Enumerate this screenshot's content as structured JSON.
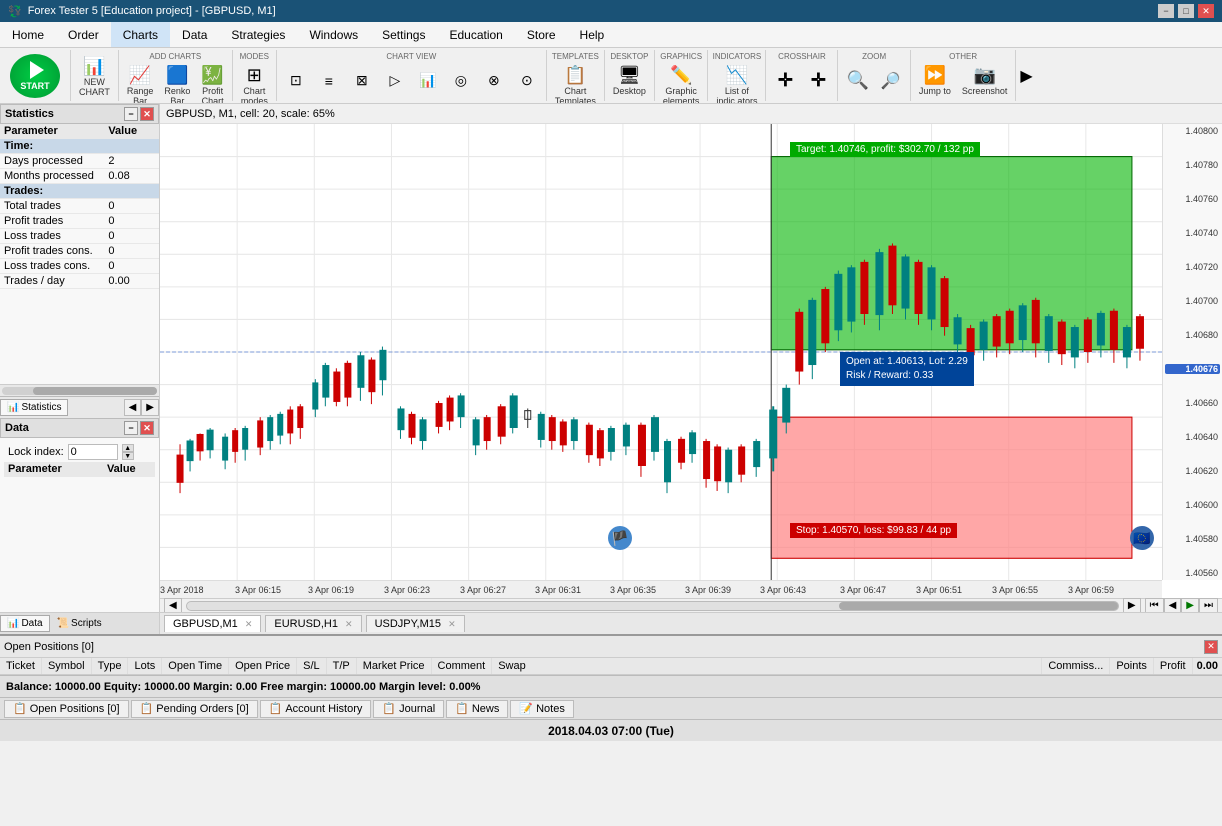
{
  "titleBar": {
    "title": "Forex Tester 5 [Education project] - [GBPUSD, M1]",
    "minimize": "−",
    "maximize": "□",
    "close": "✕"
  },
  "menuBar": {
    "items": [
      "Home",
      "Order",
      "Charts",
      "Data",
      "Strategies",
      "Windows",
      "Settings",
      "Education",
      "Store",
      "Help"
    ]
  },
  "toolbar": {
    "sections": [
      {
        "label": "",
        "items": [
          {
            "label": "NEW\nCHART",
            "icon": "📊"
          }
        ]
      },
      {
        "label": "ADD CHARTS",
        "items": [
          {
            "label": "Range\nBar",
            "icon": "📈"
          },
          {
            "label": "Renko\nBar",
            "icon": "🟦"
          },
          {
            "label": "Profit\nChart",
            "icon": "💹"
          }
        ]
      },
      {
        "label": "MODES",
        "items": [
          {
            "label": "Chart\nmodes",
            "icon": "⊞"
          }
        ]
      },
      {
        "label": "CHART VIEW",
        "items": [
          {
            "label": "",
            "icon": "⊡"
          },
          {
            "label": "",
            "icon": "≡"
          },
          {
            "label": "",
            "icon": "⊠"
          },
          {
            "label": "",
            "icon": "⊳"
          },
          {
            "label": "",
            "icon": "📊"
          },
          {
            "label": "",
            "icon": "⊚"
          },
          {
            "label": "",
            "icon": "⊘"
          },
          {
            "label": "",
            "icon": "⊙"
          }
        ]
      },
      {
        "label": "TEMPLATES",
        "items": [
          {
            "label": "Chart\nTemplates",
            "icon": "📋"
          }
        ]
      },
      {
        "label": "DESKTOP",
        "items": [
          {
            "label": "Desktop",
            "icon": "🖥"
          }
        ]
      },
      {
        "label": "GRAPHICS",
        "items": [
          {
            "label": "Graphic\nelements",
            "icon": "✏️"
          }
        ]
      },
      {
        "label": "INDICATORS",
        "items": [
          {
            "label": "List of\nindic ators",
            "icon": "📉"
          }
        ]
      },
      {
        "label": "CROSSHAIR",
        "items": [
          {
            "label": "",
            "icon": "✛"
          },
          {
            "label": "",
            "icon": "✛"
          }
        ]
      },
      {
        "label": "ZOOM",
        "items": [
          {
            "label": "",
            "icon": "🔍"
          },
          {
            "label": "",
            "icon": "🔎"
          }
        ]
      },
      {
        "label": "OTHER",
        "items": [
          {
            "label": "Jump to",
            "icon": "⏩"
          },
          {
            "label": "Screenshot",
            "icon": "📷"
          }
        ]
      }
    ]
  },
  "leftPanel": {
    "statistics": {
      "title": "Statistics",
      "colParam": "Parameter",
      "colValue": "Value",
      "sections": [
        {
          "type": "header",
          "param": "Parameter",
          "value": "Value"
        },
        {
          "type": "section",
          "param": "Time:",
          "value": ""
        },
        {
          "type": "row",
          "param": "Days processed",
          "value": "2"
        },
        {
          "type": "row",
          "param": "Months processed",
          "value": "0.08"
        },
        {
          "type": "section",
          "param": "Trades:",
          "value": ""
        },
        {
          "type": "row",
          "param": "Total trades",
          "value": "0"
        },
        {
          "type": "row",
          "param": "Profit trades",
          "value": "0"
        },
        {
          "type": "row",
          "param": "Loss trades",
          "value": "0"
        },
        {
          "type": "row",
          "param": "Profit trades cons.",
          "value": "0"
        },
        {
          "type": "row",
          "param": "Loss trades cons.",
          "value": "0"
        },
        {
          "type": "row",
          "param": "Trades / day",
          "value": "0.00"
        }
      ]
    },
    "dataPanel": {
      "title": "Data",
      "lockIndex": "Lock index:",
      "lockValue": "0",
      "colParam": "Parameter",
      "colValue": "Value"
    },
    "tabs": [
      {
        "label": "Statistics",
        "icon": "📊"
      },
      {
        "label": "►",
        "icon": ""
      }
    ]
  },
  "chart": {
    "infoBar": "GBPUSD, M1, cell: 20, scale: 65%",
    "targetLabel": "Target: 1.40746, profit: $302.70 / 132 pp",
    "openLabel": "Open at: 1.40613, Lot: 2.29\nRisk / Reward: 0.33",
    "stopLabel": "Stop: 1.40570, loss: $99.83 / 44 pp",
    "priceAtCrosshair": "1.40676",
    "priceScale": {
      "values": [
        "1.40800",
        "1.40780",
        "1.40760",
        "1.40740",
        "1.40720",
        "1.40700",
        "1.40680",
        "1.40660",
        "1.40640",
        "1.40620",
        "1.40600",
        "1.40580",
        "1.40560"
      ]
    },
    "timeLabels": [
      "3 Apr 2018",
      "3 Apr 06:15",
      "3 Apr 06:19",
      "3 Apr 06:23",
      "3 Apr 06:27",
      "3 Apr 06:31",
      "3 Apr 06:35",
      "3 Apr 06:39",
      "3 Apr 06:43",
      "3 Apr 06:47",
      "3 Apr 06:51",
      "3 Apr 06:55",
      "3 Apr 06:59"
    ]
  },
  "chartTabs": [
    {
      "label": "GBPUSD,M1",
      "closable": true
    },
    {
      "label": "EURUSD,H1",
      "closable": true
    },
    {
      "label": "USDJPY,M15",
      "closable": false
    }
  ],
  "bottomPanel": {
    "title": "Open Positions [0]",
    "columns": [
      "Ticket",
      "Symbol",
      "Type",
      "Lots",
      "Open Time",
      "Open Price",
      "S/L",
      "T/P",
      "Market Price",
      "Comment",
      "Swap",
      "Commiss...",
      "Points",
      "Profit"
    ],
    "profitValue": "0.00",
    "statusBar": "Balance: 10000.00  Equity: 10000.00  Margin: 0.00  Free margin: 10000.00  Margin level: 0.00%"
  },
  "bottomTabs": [
    {
      "label": "Open Positions [0]",
      "icon": "📋"
    },
    {
      "label": "Pending Orders [0]",
      "icon": "📋"
    },
    {
      "label": "Account History",
      "icon": "📋"
    },
    {
      "label": "Journal",
      "icon": "📋"
    },
    {
      "label": "News",
      "icon": "📋"
    },
    {
      "label": "Notes",
      "icon": "📋"
    }
  ],
  "dateBar": {
    "date": "2018.04.03 07:00 (Tue)"
  }
}
